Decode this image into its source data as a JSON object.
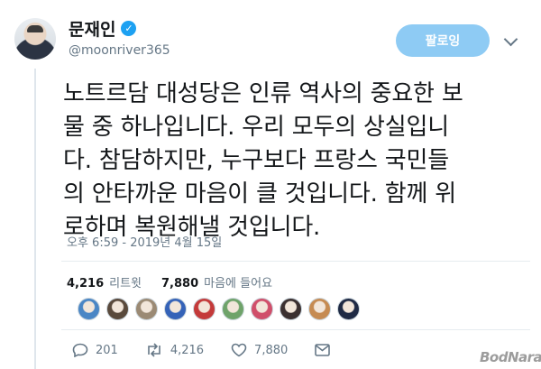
{
  "header": {
    "display_name": "문재인",
    "verified_icon": "check-mark",
    "handle": "@moonriver365",
    "follow_label": "팔로잉",
    "menu_icon": "chevron-down-icon"
  },
  "tweet": {
    "text": "노트르담 대성당은 인류 역사의 중요한 보\n물 중 하나입니다. 우리 모두의 상실입니\n다. 참담하지만, 누구보다 프랑스 국민들\n의 안타까운 마음이 클 것입니다. 함께 위\n로하며 복원해낼 것입니다.",
    "timestamp": "오후 6:59 - 2019년 4월 15일"
  },
  "stats": {
    "retweets_count": "4,216",
    "retweets_label": "리트윗",
    "likes_count": "7,880",
    "likes_label": "마음에 들어요"
  },
  "likers": [
    {
      "color": "#4a86c5"
    },
    {
      "color": "#5a4a3c"
    },
    {
      "color": "#9b8a74"
    },
    {
      "color": "#3563b8"
    },
    {
      "color": "#c43a3a"
    },
    {
      "color": "#6fa36a"
    },
    {
      "color": "#d04f6a"
    },
    {
      "color": "#3b3030"
    },
    {
      "color": "#c68b52"
    },
    {
      "color": "#1f2a44"
    }
  ],
  "actions": {
    "reply_count": "201",
    "retweet_count": "4,216",
    "like_count": "7,880"
  },
  "watermark": "BodNara",
  "colors": {
    "accent": "#1da1f2",
    "follow_button": "#8ecbf4",
    "secondary_text": "#657786"
  }
}
